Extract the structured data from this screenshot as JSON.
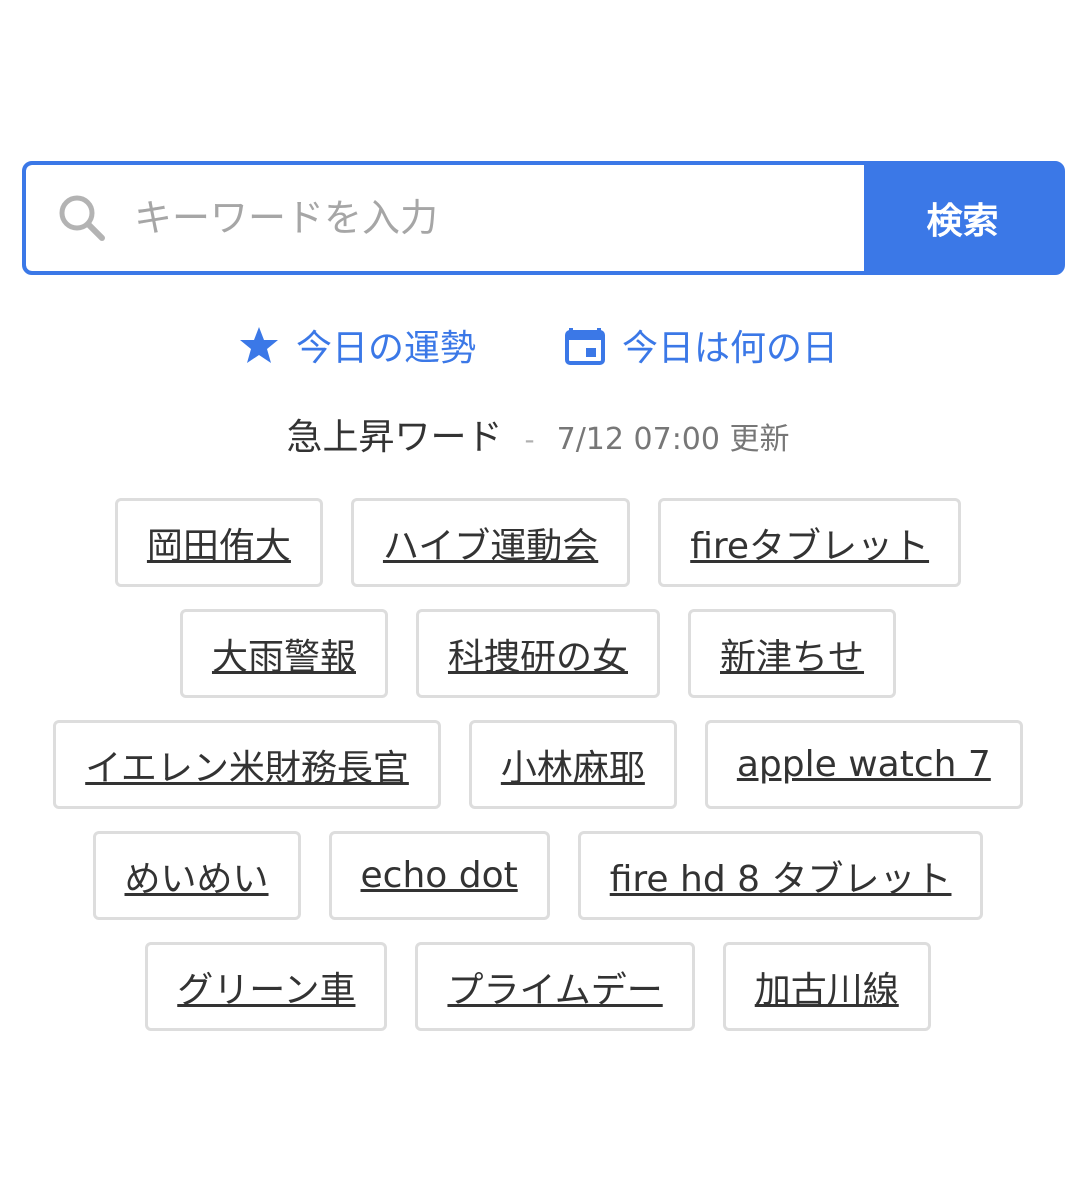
{
  "search": {
    "placeholder": "キーワードを入力",
    "button_label": "検索",
    "icon": "search-icon"
  },
  "quick_links": [
    {
      "label": "今日の運勢",
      "icon": "star-icon"
    },
    {
      "label": "今日は何の日",
      "icon": "calendar-icon"
    }
  ],
  "trending": {
    "title": "急上昇ワード",
    "separator": "-",
    "updated": "7/12 07:00 更新",
    "rows": [
      [
        "岡田侑大",
        "ハイブ運動会",
        "fireタブレット"
      ],
      [
        "大雨警報",
        "科捜研の女",
        "新津ちせ"
      ],
      [
        "イエレン米財務長官",
        "小林麻耶",
        "apple watch 7"
      ],
      [
        "めいめい",
        "echo dot",
        "fire hd 8 タブレット"
      ],
      [
        "グリーン車",
        "プライムデー",
        "加古川線"
      ]
    ]
  },
  "colors": {
    "accent": "#3b78e7",
    "chip_border": "#dddddd",
    "text": "#333333",
    "muted": "#777777"
  }
}
